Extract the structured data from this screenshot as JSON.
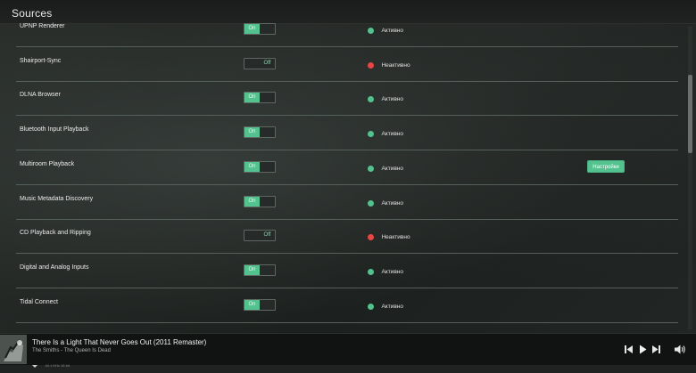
{
  "page": {
    "title": "Sources"
  },
  "colors": {
    "accent": "#53c28e",
    "active_dot": "#53c28e",
    "inactive_dot": "#e84545"
  },
  "sources": [
    {
      "name": "UPNP Renderer",
      "toggle": "On",
      "enabled": true,
      "status": "Активно",
      "active": true,
      "settings": ""
    },
    {
      "name": "Shairport-Sync",
      "toggle": "Off",
      "enabled": false,
      "status": "Неактивно",
      "active": false,
      "settings": ""
    },
    {
      "name": "DLNA Browser",
      "toggle": "On",
      "enabled": true,
      "status": "Активно",
      "active": true,
      "settings": ""
    },
    {
      "name": "Bluetooth Input Playback",
      "toggle": "On",
      "enabled": true,
      "status": "Активно",
      "active": true,
      "settings": ""
    },
    {
      "name": "Multiroom Playback",
      "toggle": "On",
      "enabled": true,
      "status": "Активно",
      "active": true,
      "settings": "Настройки"
    },
    {
      "name": "Music Metadata Discovery",
      "toggle": "On",
      "enabled": true,
      "status": "Активно",
      "active": true,
      "settings": ""
    },
    {
      "name": "CD Playback and Ripping",
      "toggle": "Off",
      "enabled": false,
      "status": "Неактивно",
      "active": false,
      "settings": ""
    },
    {
      "name": "Digital and Analog Inputs",
      "toggle": "On",
      "enabled": true,
      "status": "Активно",
      "active": true,
      "settings": ""
    },
    {
      "name": "Tidal Connect",
      "toggle": "On",
      "enabled": true,
      "status": "Активно",
      "active": true,
      "settings": ""
    }
  ],
  "player": {
    "title": "There Is a Light That Never Goes Out (2011 Remaster)",
    "artist": "The Smiths - The Queen Is Dead",
    "quality": "44.1 KHz 16 bit",
    "icons": {
      "prev": "skip-previous-icon",
      "play": "play-icon",
      "next": "skip-next-icon",
      "volume": "volume-icon",
      "quality": "chevron-down-icon"
    }
  }
}
